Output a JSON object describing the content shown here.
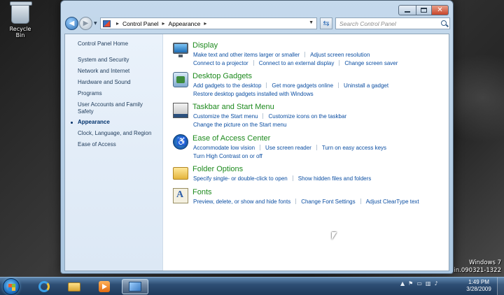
{
  "desktop": {
    "recycle_bin_label": "Recycle Bin",
    "watermark_line1": "Windows 7",
    "watermark_line2": "main.090321-1322"
  },
  "window": {
    "address": {
      "icon": "control-panel-icon",
      "crumbs": [
        "Control Panel",
        "Appearance"
      ]
    },
    "search_placeholder": "Search Control Panel"
  },
  "left_pane": {
    "items": [
      {
        "label": "Control Panel Home"
      },
      {
        "label": "System and Security"
      },
      {
        "label": "Network and Internet"
      },
      {
        "label": "Hardware and Sound"
      },
      {
        "label": "Programs"
      },
      {
        "label": "User Accounts and Family Safety"
      },
      {
        "label": "Appearance"
      },
      {
        "label": "Clock, Language, and Region"
      },
      {
        "label": "Ease of Access"
      }
    ],
    "active": "Appearance"
  },
  "categories": [
    {
      "title": "Display",
      "icon": "display-icon",
      "rows": [
        [
          "Make text and other items larger or smaller",
          "Adjust screen resolution"
        ],
        [
          "Connect to a projector",
          "Connect to an external display",
          "Change screen saver"
        ]
      ]
    },
    {
      "title": "Desktop Gadgets",
      "icon": "gadgets-icon",
      "rows": [
        [
          "Add gadgets to the desktop",
          "Get more gadgets online",
          "Uninstall a gadget"
        ],
        [
          "Restore desktop gadgets installed with Windows"
        ]
      ]
    },
    {
      "title": "Taskbar and Start Menu",
      "icon": "taskbar-icon",
      "rows": [
        [
          "Customize the Start menu",
          "Customize icons on the taskbar"
        ],
        [
          "Change the picture on the Start menu"
        ]
      ]
    },
    {
      "title": "Ease of Access Center",
      "icon": "ease-of-access-icon",
      "rows": [
        [
          "Accommodate low vision",
          "Use screen reader",
          "Turn on easy access keys"
        ],
        [
          "Turn High Contrast on or off"
        ]
      ]
    },
    {
      "title": "Folder Options",
      "icon": "folder-icon",
      "rows": [
        [
          "Specify single- or double-click to open",
          "Show hidden files and folders"
        ]
      ]
    },
    {
      "title": "Fonts",
      "icon": "fonts-icon",
      "rows": [
        [
          "Preview, delete, or show and hide fonts",
          "Change Font Settings",
          "Adjust ClearType text"
        ]
      ]
    }
  ],
  "taskbar": {
    "time": "1:49 PM",
    "date": "3/28/2009"
  },
  "colors": {
    "link": "#0b4ea2",
    "category_title": "#1e8a1e",
    "left_pane_bg": "#e4eef9"
  }
}
